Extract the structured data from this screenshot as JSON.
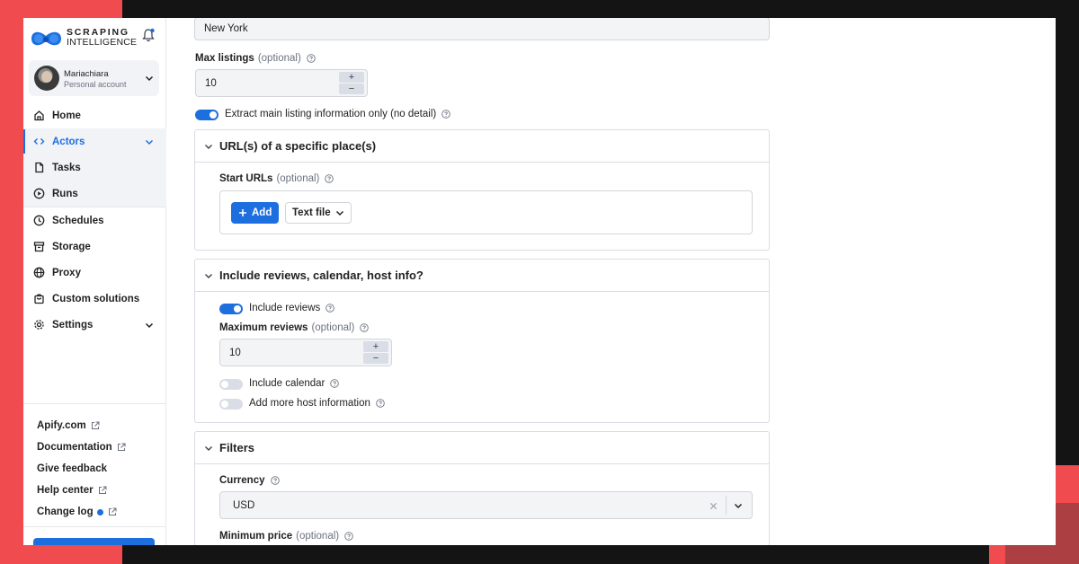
{
  "brand": {
    "line1": "SCRAPING",
    "line2": "INTELLIGENCE"
  },
  "account": {
    "name": "Mariachiara",
    "type": "Personal account"
  },
  "nav": {
    "home": "Home",
    "actors": "Actors",
    "tasks": "Tasks",
    "runs": "Runs",
    "schedules": "Schedules",
    "storage": "Storage",
    "proxy": "Proxy",
    "custom": "Custom solutions",
    "settings": "Settings"
  },
  "footer": {
    "apify": "Apify.com",
    "docs": "Documentation",
    "feedback": "Give feedback",
    "help": "Help center",
    "changelog": "Change log"
  },
  "form": {
    "location_value": "New York",
    "max_listings_label": "Max listings",
    "max_listings_opt": "(optional)",
    "max_listings_value": "10",
    "extract_main_label": "Extract main listing information only (no detail)",
    "extract_main_on": true,
    "sec_urls_title": "URL(s) of a specific place(s)",
    "start_urls_label": "Start URLs",
    "start_urls_opt": "(optional)",
    "add_label": "Add",
    "text_file_label": "Text file",
    "sec_reviews_title": "Include reviews, calendar, host info?",
    "include_reviews_label": "Include reviews",
    "include_reviews_on": true,
    "max_reviews_label": "Maximum reviews",
    "max_reviews_opt": "(optional)",
    "max_reviews_value": "10",
    "include_calendar_label": "Include calendar",
    "include_calendar_on": false,
    "host_info_label": "Add more host information",
    "host_info_on": false,
    "sec_filters_title": "Filters",
    "currency_label": "Currency",
    "currency_value": "USD",
    "min_price_label": "Minimum price",
    "min_price_opt": "(optional)",
    "stepper_plus": "+",
    "stepper_minus": "−"
  },
  "colors": {
    "accent": "#1d6fe0",
    "background_red": "#f04b4f",
    "background_dark": "#141414"
  }
}
